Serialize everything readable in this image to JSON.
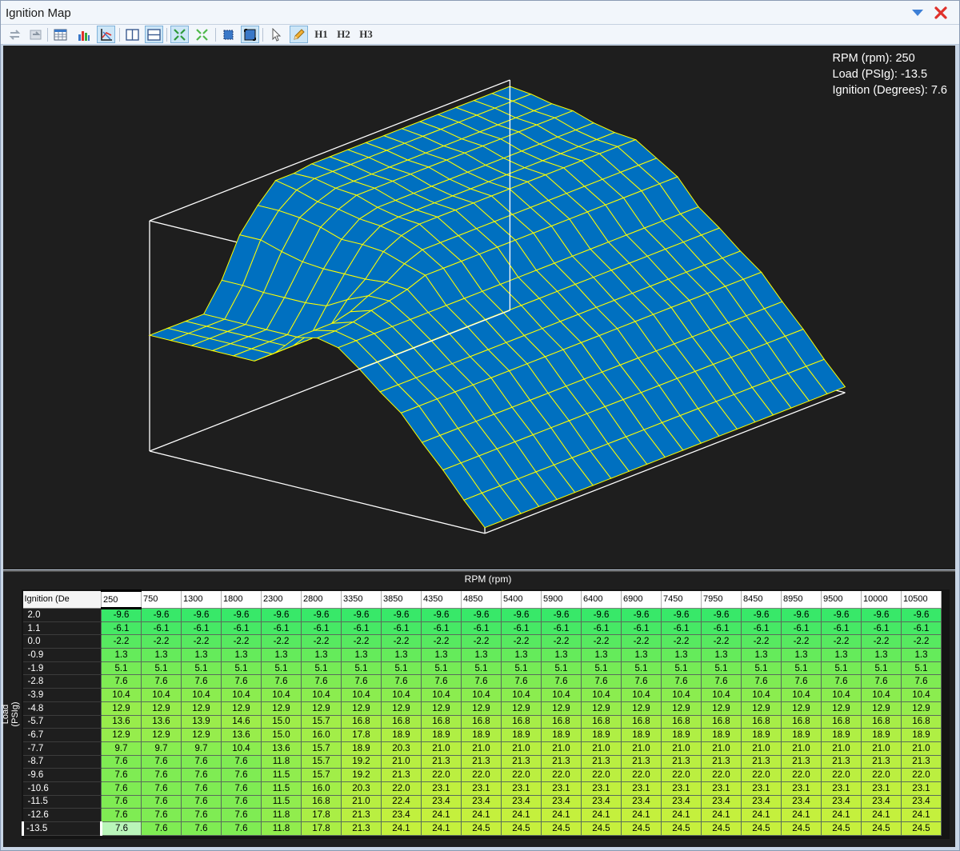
{
  "window": {
    "title": "Ignition Map"
  },
  "toolbar": {
    "buttons": [
      {
        "name": "undo-button",
        "icon": "swap-arrows-icon"
      },
      {
        "name": "redo-button",
        "icon": "refresh-icon"
      },
      {
        "name": "table-view-button",
        "icon": "table-icon"
      },
      {
        "name": "bar-chart-button",
        "icon": "bar-chart-icon"
      },
      {
        "name": "graph-toggle-button",
        "icon": "graph-axes-icon"
      },
      {
        "name": "split-vertical-button",
        "icon": "split-vertical-icon"
      },
      {
        "name": "split-horizontal-button",
        "icon": "split-horizontal-icon"
      },
      {
        "name": "expand-button",
        "icon": "expand-arrows-icon"
      },
      {
        "name": "collapse-button",
        "icon": "collapse-arrows-icon"
      },
      {
        "name": "select-region-button",
        "icon": "select-region-icon"
      },
      {
        "name": "fit-view-button",
        "icon": "fit-view-icon"
      },
      {
        "name": "pointer-tool-button",
        "icon": "pointer-icon"
      },
      {
        "name": "pencil-tool-button",
        "icon": "pencil-icon"
      }
    ],
    "h1": "H1",
    "h2": "H2",
    "h3": "H3"
  },
  "readout": {
    "rpm": "RPM (rpm): 250",
    "load": "Load (PSIg): -13.5",
    "ignition": "Ignition (Degrees): 7.6"
  },
  "table": {
    "x_title": "RPM (rpm)",
    "y_title": "Load (PSIg)",
    "corner": "Ignition (De",
    "rpm": [
      "250",
      "750",
      "1300",
      "1800",
      "2300",
      "2800",
      "3350",
      "3850",
      "4350",
      "4850",
      "5400",
      "5900",
      "6400",
      "6900",
      "7450",
      "7950",
      "8450",
      "8950",
      "9500",
      "10000",
      "10500"
    ],
    "load": [
      "2.0",
      "1.1",
      "0.0",
      "-0.9",
      "-1.9",
      "-2.8",
      "-3.9",
      "-4.8",
      "-5.7",
      "-6.7",
      "-7.7",
      "-8.7",
      "-9.6",
      "-10.6",
      "-11.5",
      "-12.6",
      "-13.5"
    ],
    "values": [
      [
        "-9.6",
        "-9.6",
        "-9.6",
        "-9.6",
        "-9.6",
        "-9.6",
        "-9.6",
        "-9.6",
        "-9.6",
        "-9.6",
        "-9.6",
        "-9.6",
        "-9.6",
        "-9.6",
        "-9.6",
        "-9.6",
        "-9.6",
        "-9.6",
        "-9.6",
        "-9.6",
        "-9.6"
      ],
      [
        "-6.1",
        "-6.1",
        "-6.1",
        "-6.1",
        "-6.1",
        "-6.1",
        "-6.1",
        "-6.1",
        "-6.1",
        "-6.1",
        "-6.1",
        "-6.1",
        "-6.1",
        "-6.1",
        "-6.1",
        "-6.1",
        "-6.1",
        "-6.1",
        "-6.1",
        "-6.1",
        "-6.1"
      ],
      [
        "-2.2",
        "-2.2",
        "-2.2",
        "-2.2",
        "-2.2",
        "-2.2",
        "-2.2",
        "-2.2",
        "-2.2",
        "-2.2",
        "-2.2",
        "-2.2",
        "-2.2",
        "-2.2",
        "-2.2",
        "-2.2",
        "-2.2",
        "-2.2",
        "-2.2",
        "-2.2",
        "-2.2"
      ],
      [
        "1.3",
        "1.3",
        "1.3",
        "1.3",
        "1.3",
        "1.3",
        "1.3",
        "1.3",
        "1.3",
        "1.3",
        "1.3",
        "1.3",
        "1.3",
        "1.3",
        "1.3",
        "1.3",
        "1.3",
        "1.3",
        "1.3",
        "1.3",
        "1.3"
      ],
      [
        "5.1",
        "5.1",
        "5.1",
        "5.1",
        "5.1",
        "5.1",
        "5.1",
        "5.1",
        "5.1",
        "5.1",
        "5.1",
        "5.1",
        "5.1",
        "5.1",
        "5.1",
        "5.1",
        "5.1",
        "5.1",
        "5.1",
        "5.1",
        "5.1"
      ],
      [
        "7.6",
        "7.6",
        "7.6",
        "7.6",
        "7.6",
        "7.6",
        "7.6",
        "7.6",
        "7.6",
        "7.6",
        "7.6",
        "7.6",
        "7.6",
        "7.6",
        "7.6",
        "7.6",
        "7.6",
        "7.6",
        "7.6",
        "7.6",
        "7.6"
      ],
      [
        "10.4",
        "10.4",
        "10.4",
        "10.4",
        "10.4",
        "10.4",
        "10.4",
        "10.4",
        "10.4",
        "10.4",
        "10.4",
        "10.4",
        "10.4",
        "10.4",
        "10.4",
        "10.4",
        "10.4",
        "10.4",
        "10.4",
        "10.4",
        "10.4"
      ],
      [
        "12.9",
        "12.9",
        "12.9",
        "12.9",
        "12.9",
        "12.9",
        "12.9",
        "12.9",
        "12.9",
        "12.9",
        "12.9",
        "12.9",
        "12.9",
        "12.9",
        "12.9",
        "12.9",
        "12.9",
        "12.9",
        "12.9",
        "12.9",
        "12.9"
      ],
      [
        "13.6",
        "13.6",
        "13.9",
        "14.6",
        "15.0",
        "15.7",
        "16.8",
        "16.8",
        "16.8",
        "16.8",
        "16.8",
        "16.8",
        "16.8",
        "16.8",
        "16.8",
        "16.8",
        "16.8",
        "16.8",
        "16.8",
        "16.8",
        "16.8"
      ],
      [
        "12.9",
        "12.9",
        "12.9",
        "13.6",
        "15.0",
        "16.0",
        "17.8",
        "18.9",
        "18.9",
        "18.9",
        "18.9",
        "18.9",
        "18.9",
        "18.9",
        "18.9",
        "18.9",
        "18.9",
        "18.9",
        "18.9",
        "18.9",
        "18.9"
      ],
      [
        "9.7",
        "9.7",
        "9.7",
        "10.4",
        "13.6",
        "15.7",
        "18.9",
        "20.3",
        "21.0",
        "21.0",
        "21.0",
        "21.0",
        "21.0",
        "21.0",
        "21.0",
        "21.0",
        "21.0",
        "21.0",
        "21.0",
        "21.0",
        "21.0"
      ],
      [
        "7.6",
        "7.6",
        "7.6",
        "7.6",
        "11.8",
        "15.7",
        "19.2",
        "21.0",
        "21.3",
        "21.3",
        "21.3",
        "21.3",
        "21.3",
        "21.3",
        "21.3",
        "21.3",
        "21.3",
        "21.3",
        "21.3",
        "21.3",
        "21.3"
      ],
      [
        "7.6",
        "7.6",
        "7.6",
        "7.6",
        "11.5",
        "15.7",
        "19.2",
        "21.3",
        "22.0",
        "22.0",
        "22.0",
        "22.0",
        "22.0",
        "22.0",
        "22.0",
        "22.0",
        "22.0",
        "22.0",
        "22.0",
        "22.0",
        "22.0"
      ],
      [
        "7.6",
        "7.6",
        "7.6",
        "7.6",
        "11.5",
        "16.0",
        "20.3",
        "22.0",
        "23.1",
        "23.1",
        "23.1",
        "23.1",
        "23.1",
        "23.1",
        "23.1",
        "23.1",
        "23.1",
        "23.1",
        "23.1",
        "23.1",
        "23.1"
      ],
      [
        "7.6",
        "7.6",
        "7.6",
        "7.6",
        "11.5",
        "16.8",
        "21.0",
        "22.4",
        "23.4",
        "23.4",
        "23.4",
        "23.4",
        "23.4",
        "23.4",
        "23.4",
        "23.4",
        "23.4",
        "23.4",
        "23.4",
        "23.4",
        "23.4"
      ],
      [
        "7.6",
        "7.6",
        "7.6",
        "7.6",
        "11.8",
        "17.8",
        "21.3",
        "23.4",
        "24.1",
        "24.1",
        "24.1",
        "24.1",
        "24.1",
        "24.1",
        "24.1",
        "24.1",
        "24.1",
        "24.1",
        "24.1",
        "24.1",
        "24.1"
      ],
      [
        "7.6",
        "7.6",
        "7.6",
        "7.6",
        "11.8",
        "17.8",
        "21.3",
        "24.1",
        "24.1",
        "24.5",
        "24.5",
        "24.5",
        "24.5",
        "24.5",
        "24.5",
        "24.5",
        "24.5",
        "24.5",
        "24.5",
        "24.5",
        "24.5"
      ]
    ],
    "selected": {
      "row": 16,
      "col": 0
    }
  },
  "colors": {
    "surface": "#0070c0",
    "mesh": "#ffff00",
    "cell_low": "#36e86a",
    "cell_high": "#c8f03c",
    "active_cell": "#b9f5b9"
  }
}
